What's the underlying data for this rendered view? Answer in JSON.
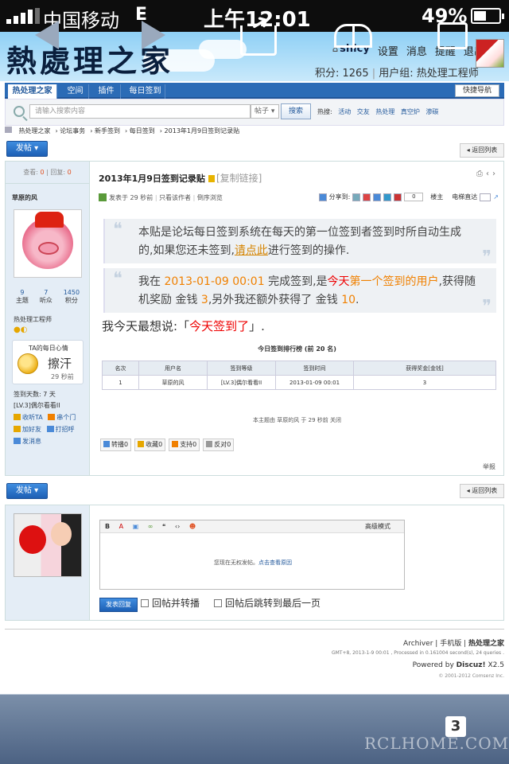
{
  "status_bar": {
    "carrier": "中国移动",
    "network": "E",
    "time": "上午12:01",
    "battery": "49%"
  },
  "site": {
    "logo": "熱處理之家",
    "username": "shlcy",
    "user_links": [
      "设置",
      "消息",
      "提醒",
      "退出"
    ],
    "points_label": "积分: 1265",
    "group_label": "用户组: 热处理工程师"
  },
  "nav": {
    "tabs": [
      "热处理之家",
      "空间",
      "插件",
      "每日签到"
    ],
    "quick_nav": "快捷导航"
  },
  "search": {
    "placeholder": "请输入搜索内容",
    "type": "帖子",
    "button": "搜索",
    "hot_label": "热搜:",
    "hot_terms": [
      "活动",
      "交友",
      "热处理",
      "真空炉",
      "渗碳"
    ]
  },
  "breadcrumb": [
    "热处理之家",
    "论坛事务",
    "新手签到",
    "每日签到",
    "2013年1月9日签到记录贴"
  ],
  "buttons": {
    "post": "发帖",
    "back": "返回列表"
  },
  "thread": {
    "views_label": "查看:",
    "views": "0",
    "replies_label": "回复:",
    "replies": "0",
    "title": "2013年1月9日签到记录贴",
    "copy_link": "[复制链接]"
  },
  "author": {
    "name": "草原的风",
    "stats": [
      {
        "value": "9",
        "label": "主题"
      },
      {
        "value": "7",
        "label": "听众"
      },
      {
        "value": "1450",
        "label": "积分"
      }
    ],
    "group": "热处理工程师",
    "mood_title": "TA的每日心情",
    "mood_text": "擦汗",
    "mood_time": "29 秒前",
    "sign_days": "签到天数: 7 天",
    "level": "[LV.3]偶尔看看II",
    "actions": [
      "收听TA",
      "串个门",
      "加好友",
      "打招呼",
      "发消息"
    ]
  },
  "post_meta": {
    "posted": "发表于 29 秒前",
    "only_author": "只看该作者",
    "reverse": "倒序浏览",
    "share_label": "分享到:",
    "share_count": "0",
    "floor": "楼主",
    "jump_label": "电梯直达"
  },
  "content": {
    "quote1_a": "本贴是论坛每日签到系统在每天的第一位签到者签到时所自动生成的,如果您还未签到,",
    "quote1_link": "请点此",
    "quote1_b": "进行签到的操作.",
    "q2_a": "我在 ",
    "q2_time": "2013-01-09 00:01",
    "q2_b": " 完成签到,是",
    "q2_today": "今天",
    "q2_first": "第一个签到的用户",
    "q2_c": ",获得随机奖励 金钱 ",
    "q2_money": "3",
    "q2_d": ",另外我还额外获得了 金钱 ",
    "q2_extra": "10",
    "q2_e": ".",
    "say_a": "我今天最想说:「",
    "say_red": "今天签到了",
    "say_b": "」."
  },
  "rank": {
    "title": "今日签到排行榜 (前 20 名)",
    "headers": [
      "名次",
      "用户名",
      "签到等级",
      "签到时间",
      "获得奖金[金钱]"
    ],
    "rows": [
      [
        "1",
        "草原的风",
        "[LV.3]偶尔看看II",
        "2013-01-09 00:01",
        "3"
      ]
    ]
  },
  "closed_note": "本主题由 草原的风 于 29 秒前 关闭",
  "post_actions": [
    "转播0",
    "收藏0",
    "支持0",
    "反对0"
  ],
  "report": "举报",
  "editor": {
    "advanced": "高级模式",
    "no_perm": "您现在无权发帖。",
    "view_reason": "点击查看原因",
    "submit": "发表回复",
    "check1": "回帖并转播",
    "check2": "回帖后跳转到最后一页"
  },
  "footer": {
    "links": [
      "Archiver",
      "手机版",
      "热处理之家"
    ],
    "gmt": "GMT+8, 2013-1-9 00:01 , Processed in 0.161004 second(s), 24 queries .",
    "powered_a": "Powered by ",
    "powered_b": "Discuz!",
    "powered_c": " X2.5",
    "copyright": "© 2001-2012 Comsenz Inc."
  },
  "browser": {
    "tab_count": "3"
  },
  "watermark": "RCLHOME.COM"
}
